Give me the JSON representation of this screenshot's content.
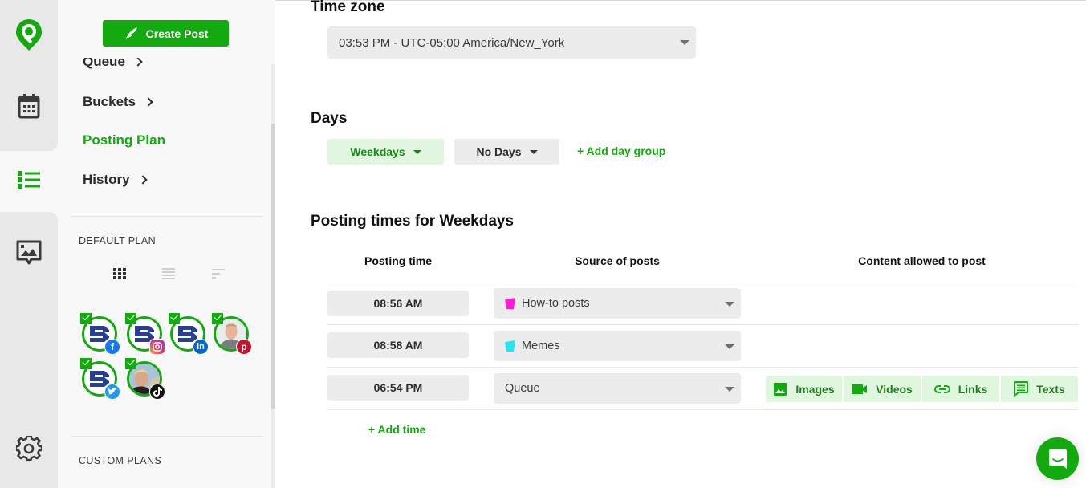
{
  "colors": {
    "brand_green": "#13aa0f",
    "light_green_bg": "#e0f6df",
    "rail_bg": "#e8e8e8",
    "sidebar_bg": "#f8f8f8",
    "field_bg": "#ececec",
    "howto_bucket": "#ff1ad9",
    "memes_bucket": "#22e6f0"
  },
  "rail": {
    "items": [
      {
        "icon": "logo-pin-icon",
        "label": "Home"
      },
      {
        "icon": "calendar-icon",
        "label": "Calendar"
      },
      {
        "icon": "list-icon",
        "label": "Publishing",
        "active": true
      },
      {
        "icon": "image-message-icon",
        "label": "Media"
      },
      {
        "icon": "gear-icon",
        "label": "Settings"
      }
    ]
  },
  "sidebar": {
    "create_post_label": "Create Post",
    "nav": [
      {
        "label": "Queue",
        "chevron": true
      },
      {
        "label": "Buckets",
        "chevron": true
      },
      {
        "label": "Posting Plan",
        "active": true
      },
      {
        "label": "History",
        "chevron": true
      }
    ],
    "default_plan_label": "DEFAULT PLAN",
    "view_toggles": [
      "grid-view",
      "list-view",
      "compact-view"
    ],
    "accounts": [
      {
        "type": "brand-logo",
        "network": "facebook",
        "checked": true
      },
      {
        "type": "brand-logo",
        "network": "instagram",
        "checked": true
      },
      {
        "type": "brand-logo",
        "network": "linkedin",
        "checked": true
      },
      {
        "type": "person-photo",
        "network": "pinterest",
        "checked": true
      },
      {
        "type": "brand-logo",
        "network": "twitter",
        "checked": true
      },
      {
        "type": "person-photo",
        "network": "tiktok",
        "checked": true
      }
    ],
    "custom_plans_label": "CUSTOM PLANS"
  },
  "main": {
    "timezone": {
      "title": "Time zone",
      "value": "03:53 PM - UTC-05:00 America/New_York"
    },
    "days": {
      "title": "Days",
      "groups": [
        {
          "label": "Weekdays",
          "selected": true
        },
        {
          "label": "No Days",
          "selected": false
        }
      ],
      "add_label": "+ Add day group"
    },
    "posting_times": {
      "title": "Posting times for Weekdays",
      "columns": [
        "Posting time",
        "Source of posts",
        "Content allowed to post"
      ],
      "rows": [
        {
          "time": "08:56 AM",
          "source": "How-to posts",
          "source_icon": "bucket-icon-magenta",
          "content": []
        },
        {
          "time": "08:58 AM",
          "source": "Memes",
          "source_icon": "bucket-icon-cyan",
          "content": []
        },
        {
          "time": "06:54 PM",
          "source": "Queue",
          "source_icon": null,
          "content": [
            "Images",
            "Videos",
            "Links",
            "Texts"
          ]
        }
      ],
      "add_time_label": "+ Add time"
    }
  }
}
